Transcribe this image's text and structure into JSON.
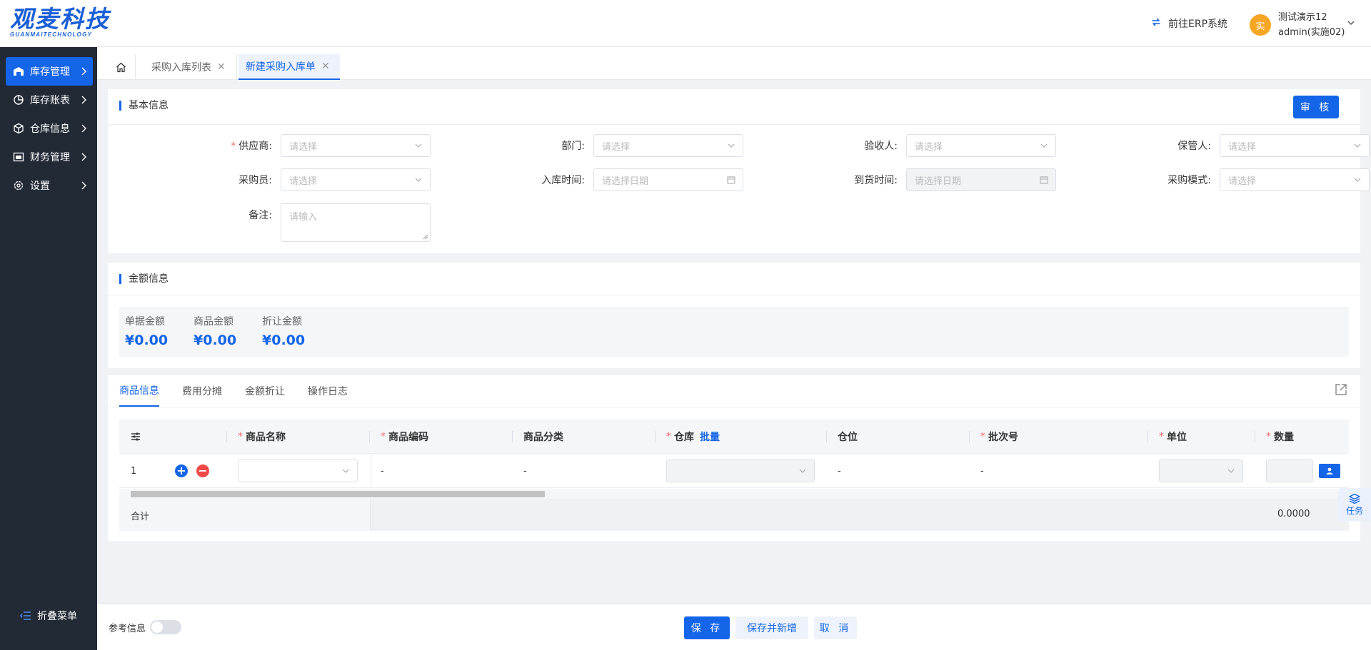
{
  "header": {
    "logo_main": "观麦科技",
    "logo_sub": "GUANMAITECHNOLOGY",
    "erp_link": "前往ERP系统",
    "avatar_char": "实",
    "user_name": "测试演示12",
    "user_account": "admin(实施02)"
  },
  "sidebar": {
    "items": [
      {
        "label": "库存管理",
        "icon": "warehouse-icon"
      },
      {
        "label": "库存账表",
        "icon": "pie-chart-icon"
      },
      {
        "label": "仓库信息",
        "icon": "cube-icon"
      },
      {
        "label": "财务管理",
        "icon": "finance-icon"
      },
      {
        "label": "设置",
        "icon": "gear-icon"
      }
    ],
    "collapse_label": "折叠菜单"
  },
  "tabs": {
    "home_icon": "home-icon",
    "items": [
      {
        "label": "采购入库列表"
      },
      {
        "label": "新建采购入库单"
      }
    ],
    "close": "✕"
  },
  "basic": {
    "title": "基本信息",
    "audit_button": "审 核",
    "fields": {
      "supplier": {
        "label": "供应商:",
        "placeholder": "请选择"
      },
      "department": {
        "label": "部门:",
        "placeholder": "请选择"
      },
      "inspector": {
        "label": "验收人:",
        "placeholder": "请选择"
      },
      "keeper": {
        "label": "保管人:",
        "placeholder": "请选择"
      },
      "buyer": {
        "label": "采购员:",
        "placeholder": "请选择"
      },
      "in_time": {
        "label": "入库时间:",
        "placeholder": "请选择日期"
      },
      "arrive_time": {
        "label": "到货时间:",
        "placeholder": "请选择日期"
      },
      "purchase_mode": {
        "label": "采购模式:",
        "placeholder": "请选择"
      },
      "remark": {
        "label": "备注:",
        "placeholder": "请输入"
      }
    },
    "required_mark": "*"
  },
  "amount": {
    "title": "金额信息",
    "items": [
      {
        "label": "单据金额",
        "value": "¥0.00"
      },
      {
        "label": "商品金额",
        "value": "¥0.00"
      },
      {
        "label": "折让金额",
        "value": "¥0.00"
      }
    ]
  },
  "goods": {
    "tabs": [
      "商品信息",
      "费用分摊",
      "金额折让",
      "操作日志"
    ],
    "columns": {
      "name": "商品名称",
      "code": "商品编码",
      "category": "商品分类",
      "warehouse": "仓库",
      "batch": "批量",
      "location": "仓位",
      "batch_no": "批次号",
      "unit": "单位",
      "qty": "数量"
    },
    "row": {
      "index": "1",
      "plus": "+",
      "minus": "−",
      "code": "-",
      "category": "-",
      "location": "-",
      "batch_no": "-"
    },
    "summary": {
      "label": "合计",
      "qty_total": "0.0000"
    }
  },
  "task_float": "任务",
  "footer": {
    "ref_label": "参考信息",
    "ref_toggle": false,
    "save": "保 存",
    "save_new": "保存并新增",
    "cancel": "取 消"
  },
  "colors": {
    "primary": "#1565e8",
    "sidebar_bg": "#222a36",
    "required": "#f56c6c",
    "avatar": "#f5a623"
  }
}
